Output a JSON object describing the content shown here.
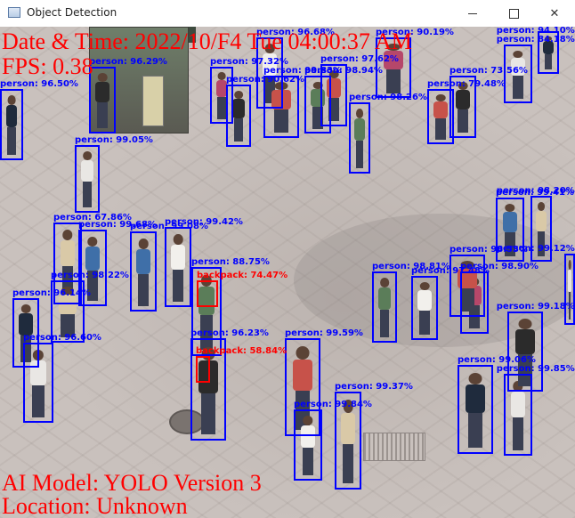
{
  "window": {
    "title": "Object Detection",
    "controls": {
      "minimize": "minimize",
      "maximize": "maximize",
      "close": "close"
    }
  },
  "overlay": {
    "datetime": "Date & Time: 2022/10/F4 Tue  04:00:37 AM",
    "fps": "FPS: 0.38",
    "model": "AI Model: YOLO Version 3",
    "location": "Location: Unknown"
  },
  "detections": [
    {
      "id": "d1",
      "label": "person: 99.05%",
      "class": "person"
    },
    {
      "id": "d2",
      "label": "person: 96.29%",
      "class": "person"
    },
    {
      "id": "d3",
      "label": "person: 97.62%",
      "class": "person"
    },
    {
      "id": "d4",
      "label": "person: 99.68%",
      "class": "person"
    },
    {
      "id": "d5",
      "label": "person: 67.86%",
      "class": "person"
    },
    {
      "id": "d6",
      "label": "person: 99.42%",
      "class": "person"
    },
    {
      "id": "d7",
      "label": "person: 88.75%",
      "class": "person"
    },
    {
      "id": "d8",
      "label": "backpack: 74.47%",
      "class": "backpack"
    },
    {
      "id": "d9",
      "label": "person: 96.14%",
      "class": "person"
    },
    {
      "id": "d10",
      "label": "person: 96.60%",
      "class": "person"
    },
    {
      "id": "d11",
      "label": "person: 96.23%",
      "class": "person"
    },
    {
      "id": "d12",
      "label": "person: 99.59%",
      "class": "person"
    },
    {
      "id": "d13",
      "label": "backpack: 58.84%",
      "class": "backpack"
    },
    {
      "id": "d14",
      "label": "person: 99.37%",
      "class": "person"
    },
    {
      "id": "d15",
      "label": "person: 99.84%",
      "class": "person"
    },
    {
      "id": "d16",
      "label": "person: 98.81%",
      "class": "person"
    },
    {
      "id": "d17",
      "label": "person: 98.90%",
      "class": "person"
    },
    {
      "id": "d18",
      "label": "person: 99.06%",
      "class": "person"
    },
    {
      "id": "d19",
      "label": "person: 99.85%",
      "class": "person"
    },
    {
      "id": "d20",
      "label": "person: 99.18%",
      "class": "person"
    },
    {
      "id": "d21",
      "label": "person: 98.53%",
      "class": "person"
    },
    {
      "id": "d22",
      "label": "person: 99.41%",
      "class": "person"
    },
    {
      "id": "d23",
      "label": "person: 98.20%",
      "class": "person"
    },
    {
      "id": "d24",
      "label": "person: 96.68%",
      "class": "person"
    },
    {
      "id": "d25",
      "label": "person: 98.94%",
      "class": "person"
    },
    {
      "id": "d26",
      "label": "person: 90.19%",
      "class": "person"
    },
    {
      "id": "d27",
      "label": "person: 94.10%",
      "class": "person"
    },
    {
      "id": "d28",
      "label": "person: 84.18%",
      "class": "person"
    },
    {
      "id": "d29",
      "label": "person: 73.56%",
      "class": "person"
    },
    {
      "id": "d30",
      "label": "person: 79.48%",
      "class": "person"
    },
    {
      "id": "d31",
      "label": "person: 99.08%",
      "class": "person"
    },
    {
      "id": "d32",
      "label": "person: 98.22%",
      "class": "person"
    },
    {
      "id": "d33",
      "label": "person: 97.48%",
      "class": "person"
    },
    {
      "id": "d34",
      "label": "person: 98.26%",
      "class": "person"
    },
    {
      "id": "d35",
      "label": "person: 97.32%",
      "class": "person"
    },
    {
      "id": "d36",
      "label": "person: 96.50%",
      "class": "person"
    },
    {
      "id": "d37",
      "label": "person: 99.12%",
      "class": "person"
    },
    {
      "id": "d38",
      "label": "person: 90.62%",
      "class": "person"
    },
    {
      "id": "d39",
      "label": "person: 99.83%",
      "class": "person"
    }
  ],
  "colors": {
    "person_box": "#0000ff",
    "backpack_box": "#ff0000",
    "overlay_text": "#ff0000"
  }
}
